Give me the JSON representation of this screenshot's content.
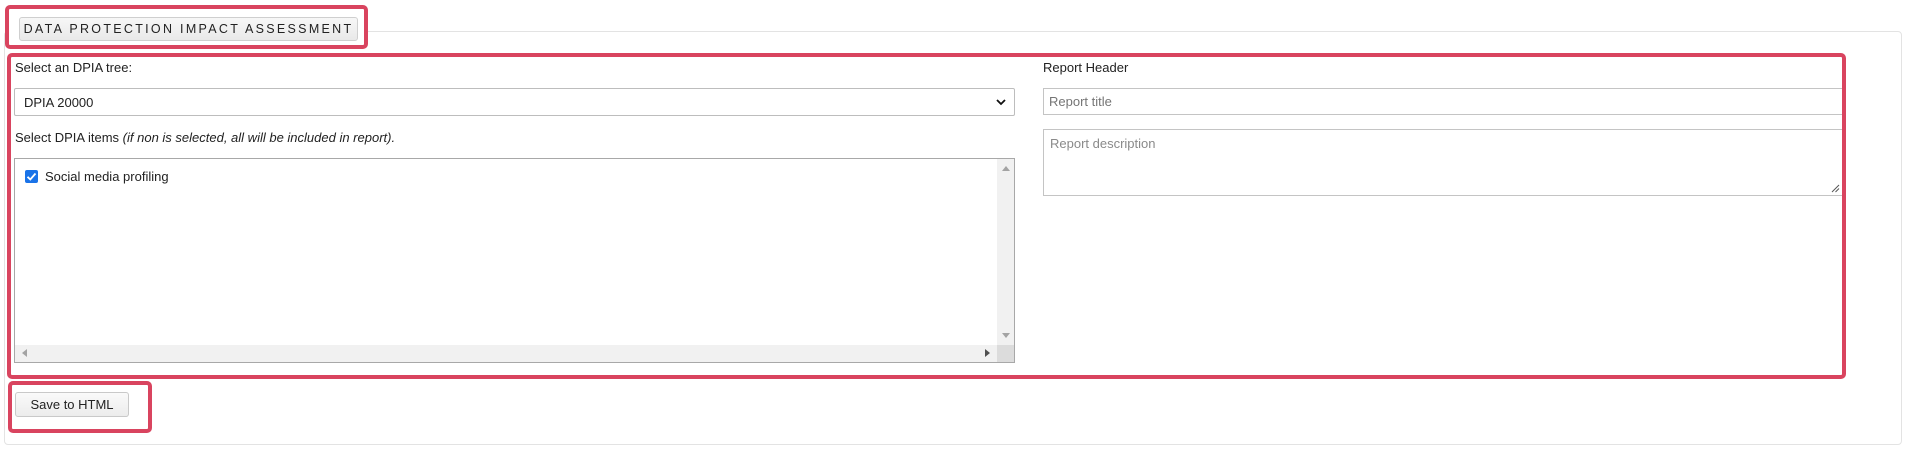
{
  "fieldset": {
    "legend": "DATA PROTECTION IMPACT ASSESSMENT"
  },
  "tree_select": {
    "label": "Select an DPIA tree:",
    "selected": "DPIA 20000"
  },
  "items": {
    "label": "Select DPIA items",
    "hint": "(if non is selected, all will be included in report).",
    "list": [
      {
        "label": "Social media profiling",
        "checked": true
      }
    ]
  },
  "report": {
    "header_label": "Report Header",
    "title_placeholder": "Report title",
    "description_placeholder": "Report description"
  },
  "actions": {
    "save_label": "Save to HTML"
  },
  "colors": {
    "highlight": "#d9445f",
    "checkbox": "#1a73e8"
  },
  "icons": {
    "select_arrow": "chevron-down-icon",
    "checkbox": "checkmark-icon",
    "resize": "resize-grip-icon"
  }
}
